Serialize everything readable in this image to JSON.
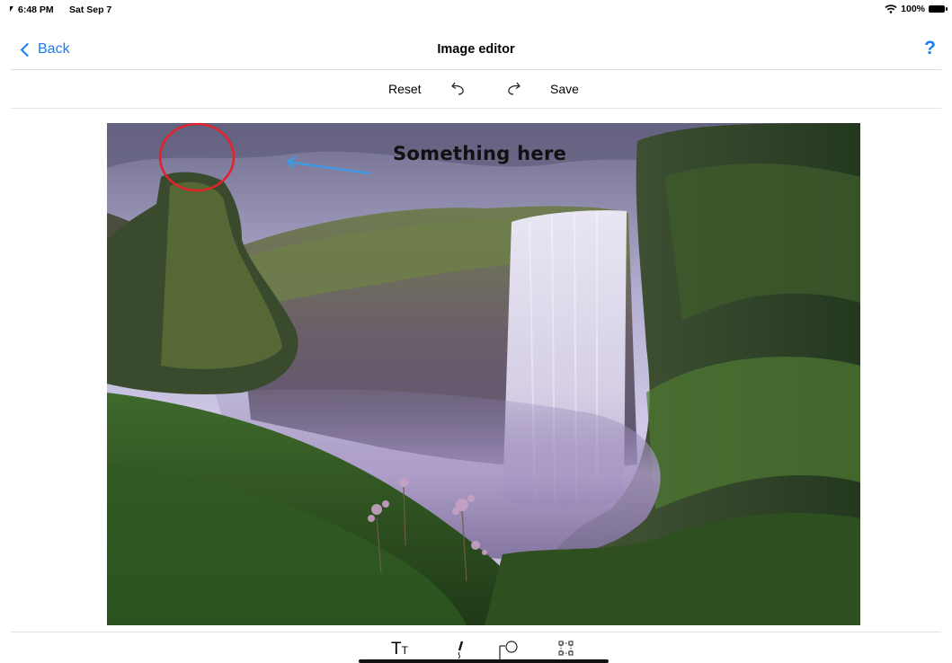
{
  "status_bar": {
    "time": "6:48 PM",
    "date": "Sat Sep 7",
    "battery": "100%",
    "icons": [
      "wifi-icon",
      "battery-icon"
    ]
  },
  "nav": {
    "back_label": "Back",
    "title": "Image editor",
    "help_label": "?"
  },
  "toolbar": {
    "reset_label": "Reset",
    "undo_icon": "undo-icon",
    "redo_icon": "redo-icon",
    "save_label": "Save"
  },
  "annotations": {
    "text": "Something here",
    "circle_icon": "red-circle-annotation",
    "arrow_icon": "blue-arrow-annotation"
  },
  "bottom_tools": {
    "text_tool": "T",
    "text_tool_small": "T",
    "pen_icon": "pen-icon",
    "shape_icon": "shape-icon",
    "group_icon": "group-icon"
  },
  "colors": {
    "accent": "#1a7cf4",
    "circle": "#e0242a",
    "arrow": "#3a9be8"
  }
}
